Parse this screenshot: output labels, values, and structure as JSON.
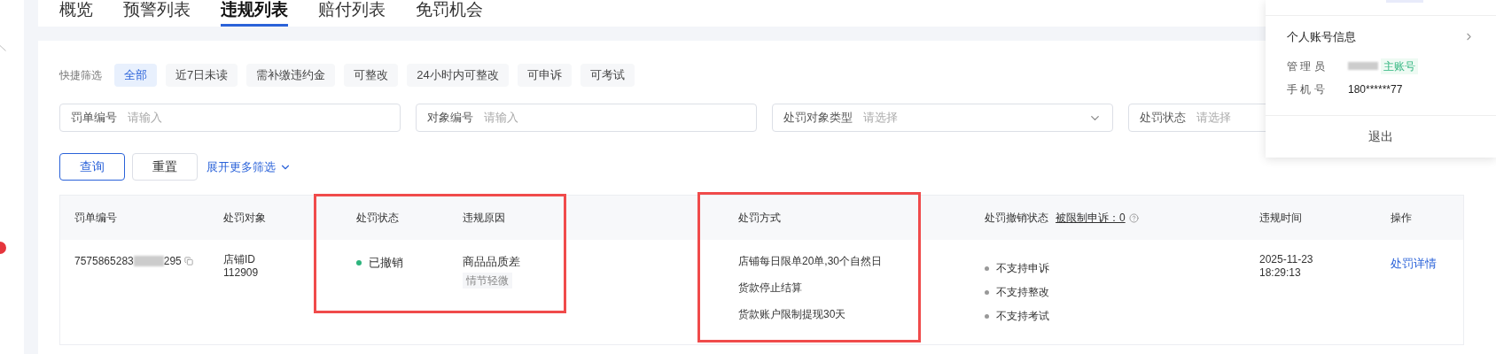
{
  "tabs": [
    {
      "label": "概览",
      "selected": false
    },
    {
      "label": "预警列表",
      "selected": false
    },
    {
      "label": "违规列表",
      "selected": true
    },
    {
      "label": "赔付列表",
      "selected": false
    },
    {
      "label": "免罚机会",
      "selected": false
    }
  ],
  "quick_filter": {
    "label": "快捷筛选",
    "chips": [
      {
        "label": "全部",
        "selected": true
      },
      {
        "label": "近7日未读",
        "selected": false
      },
      {
        "label": "需补缴违约金",
        "selected": false
      },
      {
        "label": "可整改",
        "selected": false
      },
      {
        "label": "24小时内可整改",
        "selected": false
      },
      {
        "label": "可申诉",
        "selected": false
      },
      {
        "label": "可考试",
        "selected": false
      }
    ]
  },
  "filters": [
    {
      "kind": "input",
      "label": "罚单编号",
      "placeholder": "请输入"
    },
    {
      "kind": "input",
      "label": "对象编号",
      "placeholder": "请输入"
    },
    {
      "kind": "select",
      "label": "处罚对象类型",
      "placeholder": "请选择"
    },
    {
      "kind": "input",
      "label": "处罚状态",
      "placeholder": "请选择"
    }
  ],
  "actions": {
    "query": "查询",
    "reset": "重置",
    "expand": "展开更多筛选"
  },
  "table": {
    "columns": [
      {
        "label": "罚单编号"
      },
      {
        "label": "处罚对象"
      },
      {
        "label": "处罚状态"
      },
      {
        "label": "违规原因"
      },
      {
        "label": "处罚方式"
      },
      {
        "label": "处罚撤销状态",
        "link": "被限制申诉：0"
      },
      {
        "label": "违规时间"
      },
      {
        "label": "操作"
      }
    ],
    "rows": [
      {
        "id_prefix": "7575865283",
        "id_suffix": "295",
        "target": [
          "店铺ID",
          "112909"
        ],
        "status": {
          "text": "已撤销",
          "color": "#2db47d"
        },
        "reason": "商品品质差",
        "severity": "情节轻微",
        "penalties": [
          "店铺每日限单20单,30个自然日",
          "货款停止结算",
          "货款账户限制提现30天"
        ],
        "revocation": [
          "不支持申诉",
          "不支持整改",
          "不支持考试"
        ],
        "time": [
          "2025-11-23",
          "18:29:13"
        ],
        "action": "处罚详情"
      }
    ]
  },
  "annotations": [
    {
      "kind": "red-box"
    },
    {
      "kind": "red-box"
    }
  ],
  "account_popup": {
    "title": "个人账号信息",
    "rows": [
      {
        "kind": "name",
        "label": "管 理 员",
        "tag": "主账号"
      },
      {
        "kind": "text",
        "label": "手 机 号",
        "value": "180******77"
      }
    ],
    "logout": "退出"
  }
}
